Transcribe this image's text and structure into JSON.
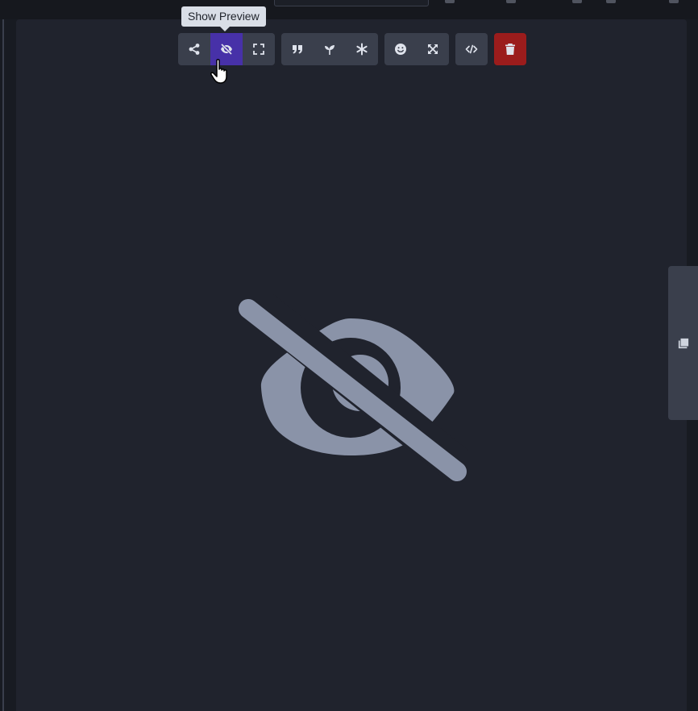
{
  "tooltip": {
    "text": "Show Preview"
  },
  "toolbar": {
    "groups": [
      {
        "buttons": [
          {
            "icon": "share-icon",
            "active": false
          },
          {
            "icon": "eye-slash-icon",
            "active": true
          },
          {
            "icon": "expand-icon",
            "active": false
          }
        ]
      },
      {
        "buttons": [
          {
            "icon": "quote-icon",
            "active": false
          },
          {
            "icon": "seedling-icon",
            "active": false
          },
          {
            "icon": "asterisk-icon",
            "active": false
          }
        ]
      },
      {
        "buttons": [
          {
            "icon": "smile-icon",
            "active": false
          },
          {
            "icon": "arrows-expand-icon",
            "active": false
          }
        ]
      },
      {
        "buttons": [
          {
            "icon": "code-icon",
            "active": false
          }
        ]
      },
      {
        "buttons": [
          {
            "icon": "trash-icon",
            "active": false,
            "danger": true
          }
        ]
      }
    ]
  },
  "preview": {
    "placeholder_icon": "eye-slash-icon"
  },
  "side_tab": {
    "icon": "image-icon"
  },
  "colors": {
    "panel": "#20232d",
    "button": "#3a3f4c",
    "active": "#4731a8",
    "danger": "#9b1c1c",
    "icon_muted": "#8a93a8"
  }
}
